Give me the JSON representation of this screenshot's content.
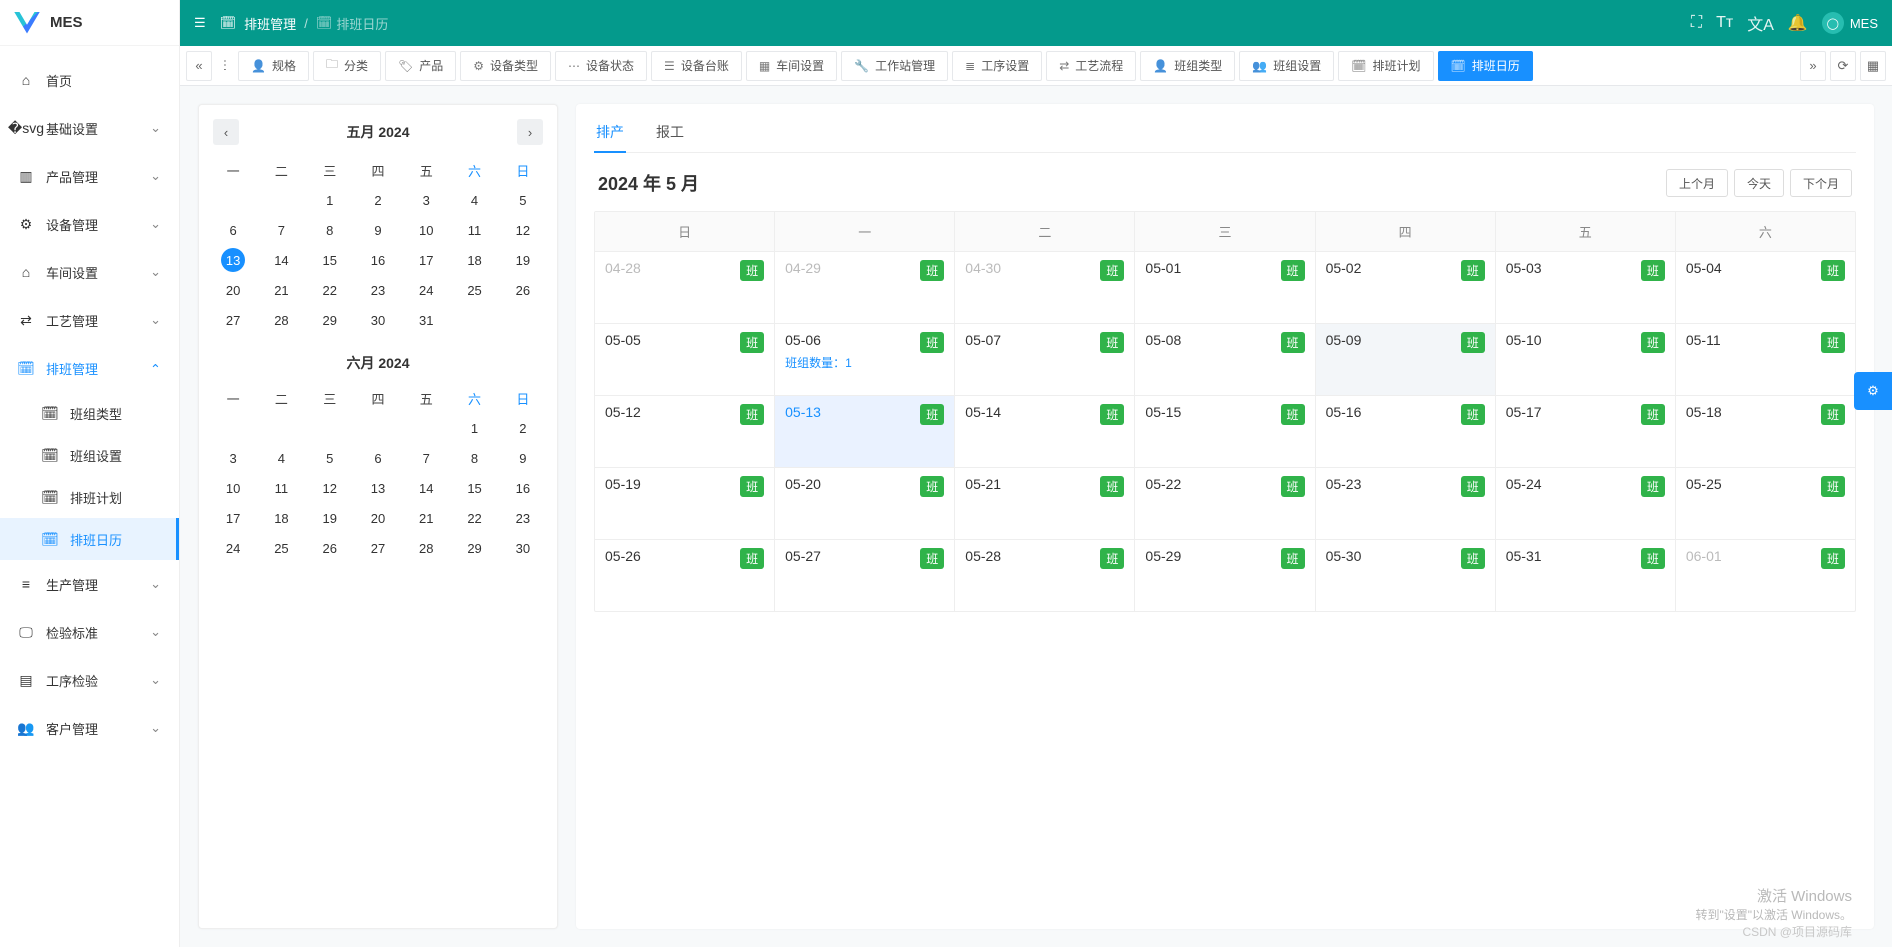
{
  "brand": {
    "name": "MES"
  },
  "breadcrumb": {
    "module": "排班管理",
    "page": "排班日历"
  },
  "user": {
    "name": "MES"
  },
  "sidebar": {
    "items": [
      {
        "label": "首页",
        "icon": "home"
      },
      {
        "label": "基础设置",
        "icon": "sliders",
        "expandable": true
      },
      {
        "label": "产品管理",
        "icon": "bars",
        "expandable": true
      },
      {
        "label": "设备管理",
        "icon": "gear",
        "expandable": true
      },
      {
        "label": "车间设置",
        "icon": "factory",
        "expandable": true
      },
      {
        "label": "工艺管理",
        "icon": "flow",
        "expandable": true
      },
      {
        "label": "排班管理",
        "icon": "calendar",
        "expandable": true,
        "open": true,
        "children": [
          {
            "label": "班组类型"
          },
          {
            "label": "班组设置"
          },
          {
            "label": "排班计划"
          },
          {
            "label": "排班日历",
            "active": true
          }
        ]
      },
      {
        "label": "生产管理",
        "icon": "db",
        "expandable": true
      },
      {
        "label": "检验标准",
        "icon": "monitor",
        "expandable": true
      },
      {
        "label": "工序检验",
        "icon": "book",
        "expandable": true
      },
      {
        "label": "客户管理",
        "icon": "users",
        "expandable": true
      }
    ]
  },
  "tabs": {
    "items": [
      {
        "label": "规格",
        "icon": "user"
      },
      {
        "label": "分类",
        "icon": "folder"
      },
      {
        "label": "产品",
        "icon": "tag"
      },
      {
        "label": "设备类型",
        "icon": "gear"
      },
      {
        "label": "设备状态",
        "icon": "dots"
      },
      {
        "label": "设备台账",
        "icon": "list"
      },
      {
        "label": "车间设置",
        "icon": "grid"
      },
      {
        "label": "工作站管理",
        "icon": "wrench"
      },
      {
        "label": "工序设置",
        "icon": "stack"
      },
      {
        "label": "工艺流程",
        "icon": "flow"
      },
      {
        "label": "班组类型",
        "icon": "user"
      },
      {
        "label": "班组设置",
        "icon": "users"
      },
      {
        "label": "排班计划",
        "icon": "calendar"
      },
      {
        "label": "排班日历",
        "icon": "calendar",
        "active": true
      }
    ]
  },
  "subtabs": {
    "items": [
      "排产",
      "报工"
    ],
    "active": 0
  },
  "big_calendar": {
    "title": "2024 年 5 月",
    "nav": {
      "prev": "上个月",
      "today": "今天",
      "next": "下个月"
    },
    "dow": [
      "日",
      "一",
      "二",
      "三",
      "四",
      "五",
      "六"
    ],
    "badge_text": "班",
    "extra_label": "班组数量：",
    "rows": [
      [
        {
          "d": "04-28",
          "dim": true
        },
        {
          "d": "04-29",
          "dim": true
        },
        {
          "d": "04-30",
          "dim": true
        },
        {
          "d": "05-01"
        },
        {
          "d": "05-02"
        },
        {
          "d": "05-03"
        },
        {
          "d": "05-04"
        }
      ],
      [
        {
          "d": "05-05"
        },
        {
          "d": "05-06",
          "extra": "1"
        },
        {
          "d": "05-07"
        },
        {
          "d": "05-08"
        },
        {
          "d": "05-09",
          "hov": true
        },
        {
          "d": "05-10"
        },
        {
          "d": "05-11"
        }
      ],
      [
        {
          "d": "05-12"
        },
        {
          "d": "05-13",
          "sel": true,
          "today": true
        },
        {
          "d": "05-14"
        },
        {
          "d": "05-15"
        },
        {
          "d": "05-16"
        },
        {
          "d": "05-17"
        },
        {
          "d": "05-18"
        }
      ],
      [
        {
          "d": "05-19"
        },
        {
          "d": "05-20"
        },
        {
          "d": "05-21"
        },
        {
          "d": "05-22"
        },
        {
          "d": "05-23"
        },
        {
          "d": "05-24"
        },
        {
          "d": "05-25"
        }
      ],
      [
        {
          "d": "05-26"
        },
        {
          "d": "05-27"
        },
        {
          "d": "05-28"
        },
        {
          "d": "05-29"
        },
        {
          "d": "05-30"
        },
        {
          "d": "05-31"
        },
        {
          "d": "06-01",
          "dim": true
        }
      ]
    ]
  },
  "mini_calendars": {
    "dow": [
      "一",
      "二",
      "三",
      "四",
      "五",
      "六",
      "日"
    ],
    "months": [
      {
        "title": "五月 2024",
        "today": 13,
        "show_nav": true,
        "weeks": [
          [
            "",
            "",
            1,
            2,
            3,
            4,
            5
          ],
          [
            6,
            7,
            8,
            9,
            10,
            11,
            12
          ],
          [
            13,
            14,
            15,
            16,
            17,
            18,
            19
          ],
          [
            20,
            21,
            22,
            23,
            24,
            25,
            26
          ],
          [
            27,
            28,
            29,
            30,
            31,
            "",
            ""
          ]
        ]
      },
      {
        "title": "六月 2024",
        "show_nav": false,
        "weeks": [
          [
            "",
            "",
            "",
            "",
            "",
            1,
            2
          ],
          [
            3,
            4,
            5,
            6,
            7,
            8,
            9
          ],
          [
            10,
            11,
            12,
            13,
            14,
            15,
            16
          ],
          [
            17,
            18,
            19,
            20,
            21,
            22,
            23
          ],
          [
            24,
            25,
            26,
            27,
            28,
            29,
            30
          ]
        ]
      }
    ]
  },
  "watermark": {
    "line1": "激活 Windows",
    "line2": "转到\"设置\"以激活 Windows。",
    "csdn": "CSDN @项目源码库"
  }
}
